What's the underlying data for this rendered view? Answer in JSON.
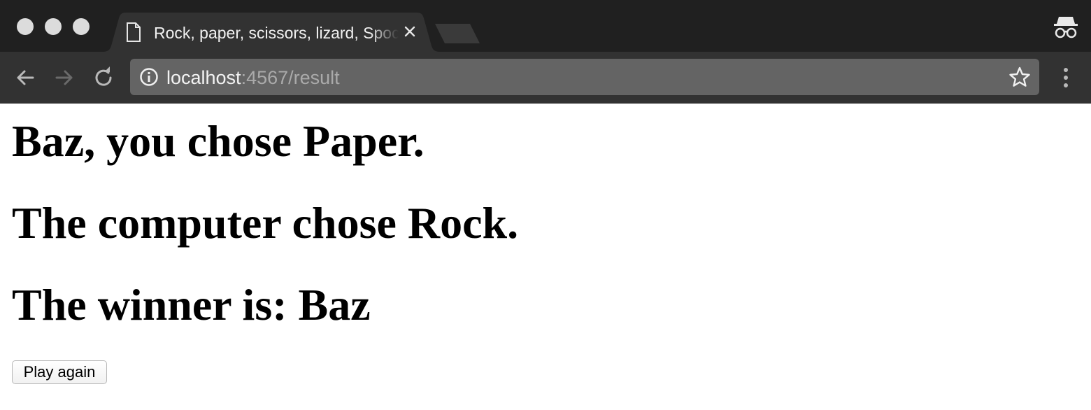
{
  "browser": {
    "tab_title": "Rock, paper, scissors, lizard, Spock",
    "url_host": "localhost",
    "url_rest": ":4567/result",
    "icons": {
      "tab": "page-icon",
      "close": "close-icon",
      "incognito": "incognito-icon",
      "back": "back-arrow-icon",
      "forward": "forward-arrow-icon",
      "reload": "reload-icon",
      "info": "info-icon",
      "bookmark": "star-icon",
      "menu": "kebab-menu-icon"
    },
    "colors": {
      "titlebar": "#202020",
      "toolbar": "#323232",
      "omnibox": "#646464"
    }
  },
  "page": {
    "player_choice": "Baz, you chose Paper.",
    "computer_choice": "The computer chose Rock.",
    "winner": "The winner is: Baz",
    "play_again_label": "Play again"
  }
}
